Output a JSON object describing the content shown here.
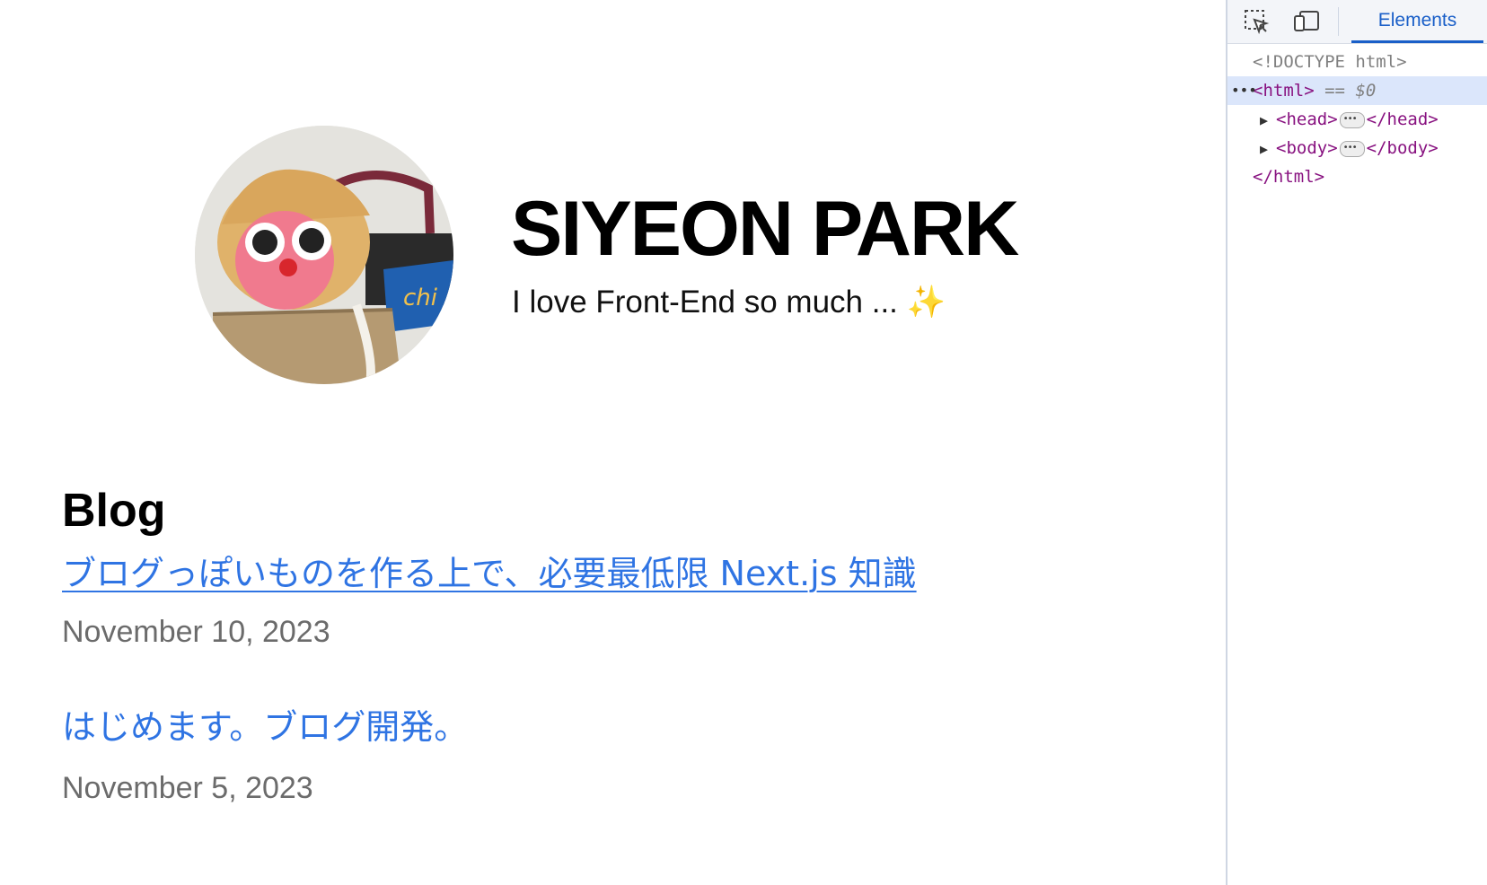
{
  "profile": {
    "name": "SIYEON PARK",
    "tagline": "I love Front-End so much ... ✨"
  },
  "blog": {
    "heading": "Blog",
    "posts": [
      {
        "title": "ブログっぽいものを作る上で、必要最低限 Next.js 知識",
        "date": "November 10, 2023"
      },
      {
        "title": "はじめます。ブログ開発。",
        "date": "November 5, 2023"
      }
    ]
  },
  "devtools": {
    "tab": "Elements",
    "lines": {
      "doctype": "<!DOCTYPE html>",
      "html_open": "<html>",
      "eq": "==",
      "dollar": "$0",
      "head_open": "<head>",
      "head_close": "</head>",
      "body_open": "<body>",
      "body_close": "</body>",
      "html_close": "</html>"
    }
  },
  "colors": {
    "link": "#2f74e3",
    "date": "#6b6b6b",
    "devtools_accent": "#1a5fc8"
  }
}
